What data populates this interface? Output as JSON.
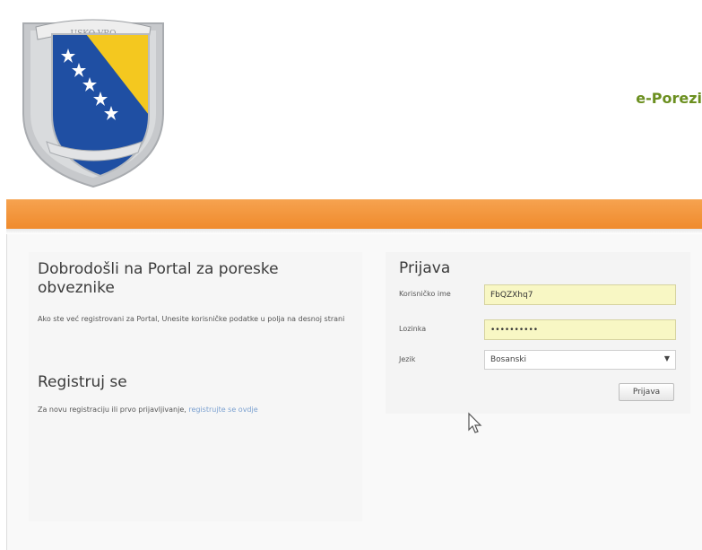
{
  "header": {
    "crest_banner_text": "USKO-VRO",
    "brand": "e-Porezi"
  },
  "welcome": {
    "title": "Dobrodošli na Portal za poreske obveznike",
    "text": "Ako ste već registrovani za Portal, Unesite korisničke podatke u polja na desnoj strani"
  },
  "register": {
    "title": "Registruj se",
    "text": "Za novu registraciju ili prvo prijavljivanje,",
    "link": "registrujte se ovdje"
  },
  "login": {
    "title": "Prijava",
    "username_label": "Korisničko ime",
    "username_value": "FbQZXhq7",
    "password_label": "Lozinka",
    "password_value": "••••••••••",
    "language_label": "Jezik",
    "language_value": "Bosanski",
    "submit_label": "Prijava"
  },
  "colors": {
    "orange_band": "#ef8a2b",
    "brand_green": "#6b8f1f",
    "input_yellow": "#f8f7c4",
    "flag_blue": "#1f4fa3",
    "flag_yellow": "#f4c81f"
  },
  "icons": {
    "crest": "bosnia-crest-icon",
    "dropdown": "chevron-down-icon",
    "cursor": "mouse-pointer-icon"
  }
}
